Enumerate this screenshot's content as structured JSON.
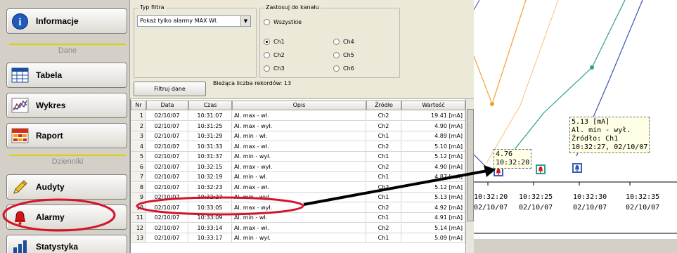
{
  "sidebar": {
    "informacje": "Informacje",
    "dane": "Dane",
    "tabela": "Tabela",
    "wykres": "Wykres",
    "raport": "Raport",
    "dzienniki": "Dzienniki",
    "audyty": "Audyty",
    "alarmy": "Alarmy",
    "statystyka": "Statystyka"
  },
  "filter": {
    "type_legend": "Typ filtra",
    "type_value": "Pokaż tylko alarmy MAX Wł.",
    "apply_legend": "Zastosuj do kanału",
    "all": "Wszystkie",
    "channels": [
      "Ch1",
      "Ch2",
      "Ch3",
      "Ch4",
      "Ch5",
      "Ch6"
    ],
    "selected_channel": "Ch1",
    "filter_button": "Filtruj dane",
    "record_count_text": "Bieżąca liczba rekordów: 13"
  },
  "table": {
    "columns": [
      "Nr",
      "Data",
      "Czas",
      "Opis",
      "Źródło",
      "Wartość"
    ],
    "rows": [
      [
        "1",
        "02/10/07",
        "10:31:07",
        "Al. max - wł.",
        "Ch2",
        "19.41 [mA]"
      ],
      [
        "2",
        "02/10/07",
        "10:31:25",
        "Al. max - wył.",
        "Ch2",
        "4.90 [mA]"
      ],
      [
        "3",
        "02/10/07",
        "10:31:29",
        "Al. min - wł.",
        "Ch1",
        "4.89 [mA]"
      ],
      [
        "4",
        "02/10/07",
        "10:31:33",
        "Al. max - wł.",
        "Ch2",
        "5.10 [mA]"
      ],
      [
        "5",
        "02/10/07",
        "10:31:37",
        "Al. min - wył.",
        "Ch1",
        "5.12 [mA]"
      ],
      [
        "6",
        "02/10/07",
        "10:32:15",
        "Al. max - wył.",
        "Ch2",
        "4.90 [mA]"
      ],
      [
        "7",
        "02/10/07",
        "10:32:19",
        "Al. min - wł.",
        "Ch1",
        "4.87 [mA]"
      ],
      [
        "8",
        "02/10/07",
        "10:32:23",
        "Al. max - wł.",
        "Ch2",
        "5.12 [mA]"
      ],
      [
        "9",
        "02/10/07",
        "10:32:27",
        "Al. min - wył.",
        "Ch1",
        "5.13 [mA]"
      ],
      [
        "10",
        "02/10/07",
        "10:33:05",
        "Al. max - wył.",
        "Ch2",
        "4.92 [mA]"
      ],
      [
        "11",
        "02/10/07",
        "10:33:09",
        "Al. min - wł.",
        "Ch1",
        "4.91 [mA]"
      ],
      [
        "12",
        "02/10/07",
        "10:33:14",
        "Al. max - wł.",
        "Ch2",
        "5.14 [mA]"
      ],
      [
        "13",
        "02/10/07",
        "10:33:17",
        "Al. min - wył.",
        "Ch1",
        "5.09 [mA]"
      ]
    ]
  },
  "chart": {
    "x_ticks": [
      {
        "time": "10:32:20",
        "date": "02/10/07"
      },
      {
        "time": "10:32:25",
        "date": "02/10/07"
      },
      {
        "time": "10:32:30",
        "date": "02/10/07"
      },
      {
        "time": "10:32:35",
        "date": "02/10/07"
      }
    ],
    "tooltip_small": [
      "4.76",
      "10:32:20"
    ],
    "tooltip_large": [
      "5.13 [mA]",
      "Al. min - wył.",
      "Źródło: Ch1",
      "10:32:27, 02/10/07"
    ],
    "colors": {
      "orange": "#f0a030",
      "teal": "#2aa090",
      "blue": "#3c50b0",
      "alarm_red": "#d01818",
      "highlight": "#d4142c"
    }
  }
}
